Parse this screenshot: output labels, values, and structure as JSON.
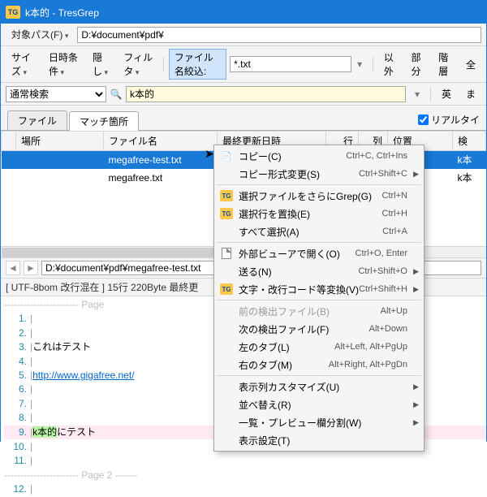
{
  "title": "k本的 - TresGrep",
  "row1": {
    "path_label": "対象パス(F)",
    "path_value": "D:¥document¥pdf¥"
  },
  "row2": {
    "size": "サイズ",
    "date": "日時条件",
    "hide": "隠し",
    "filter": "フィルタ",
    "name_narrow": "ファイル名絞込:",
    "pattern": "*.txt",
    "except": "以外",
    "partial": "部分",
    "layer": "階層",
    "all": "全"
  },
  "row3": {
    "mode": "通常検索",
    "term": "k本的",
    "eng": "英"
  },
  "tabs": {
    "file": "ファイル",
    "match": "マッチ箇所",
    "realtime": "リアルタイ"
  },
  "grid": {
    "cols": {
      "place": "場所",
      "fname": "ファイル名",
      "mtime": "最終更新日時",
      "row": "行",
      "col": "列",
      "pos": "位置",
      "det": "検"
    },
    "rows": [
      {
        "fname": "megafree-test.txt",
        "det": "k本"
      },
      {
        "fname": "megafree.txt",
        "det": "k本"
      }
    ]
  },
  "preview": {
    "path": "D:¥document¥pdf¥megafree-test.txt",
    "status": "[ UTF-8bom 改行混在 ] 15行 220Byte 最終更",
    "page1": "Page",
    "l3": "これはテスト",
    "l5": "http://www.gigafree.net/",
    "l9a": "k本的",
    "l9b": "にテスト",
    "page2": "Page 2"
  },
  "menu": {
    "copy": "コピー(C)",
    "copy_sc": "Ctrl+C, Ctrl+Ins",
    "copyfmt": "コピー形式変更(S)",
    "copyfmt_sc": "Ctrl+Shift+C",
    "grep": "選択ファイルをさらにGrep(G)",
    "grep_sc": "Ctrl+N",
    "replace": "選択行を置換(E)",
    "replace_sc": "Ctrl+H",
    "selall": "すべて選択(A)",
    "selall_sc": "Ctrl+A",
    "extview": "外部ビューアで開く(O)",
    "extview_sc": "Ctrl+O, Enter",
    "send": "送る(N)",
    "send_sc": "Ctrl+Shift+O",
    "charconv": "文字・改行コード等変換(V)",
    "charconv_sc": "Ctrl+Shift+H",
    "prevf": "前の検出ファイル(B)",
    "prevf_sc": "Alt+Up",
    "nextf": "次の検出ファイル(F)",
    "nextf_sc": "Alt+Down",
    "lefttab": "左のタブ(L)",
    "lefttab_sc": "Alt+Left, Alt+PgUp",
    "righttab": "右のタブ(M)",
    "righttab_sc": "Alt+Right, Alt+PgDn",
    "colcustom": "表示列カスタマイズ(U)",
    "sort": "並べ替え(R)",
    "splitview": "一覧・プレビュー欄分割(W)",
    "disp": "表示設定(T)"
  }
}
